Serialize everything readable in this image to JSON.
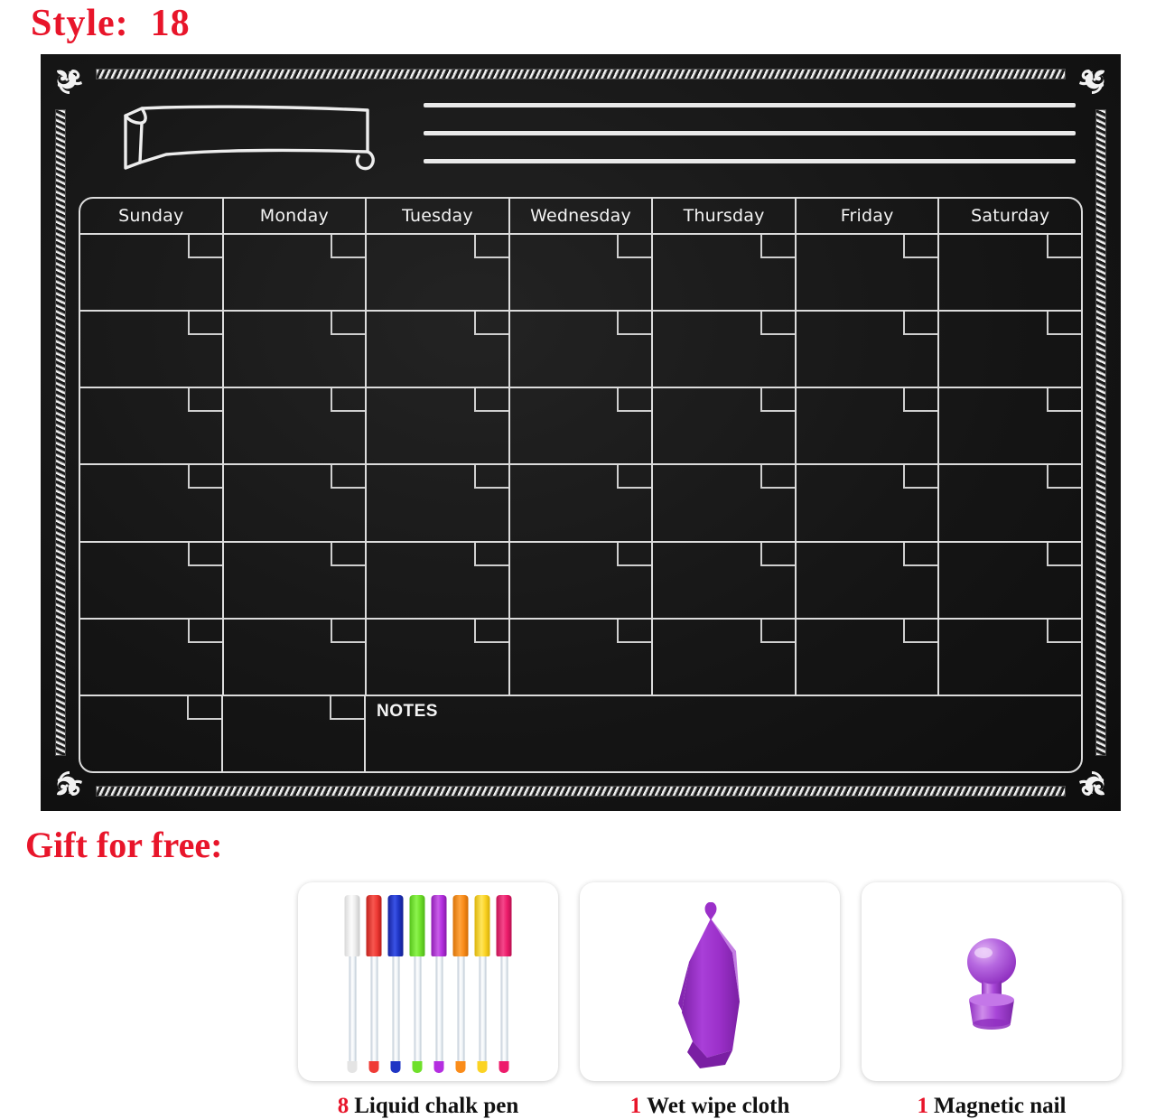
{
  "style": {
    "label": "Style:",
    "value": "18"
  },
  "board": {
    "background_color": "#161616",
    "chalk_color": "#e9e9e9",
    "ribbon_name": "month-title-ribbon",
    "date_lines_count": 3,
    "calendar": {
      "day_headers": [
        "Sunday",
        "Monday",
        "Tuesday",
        "Wednesday",
        "Thursday",
        "Friday",
        "Saturday"
      ],
      "week_rows": 6,
      "notes_row": {
        "day_cells": 2,
        "notes_label": "NOTES"
      }
    },
    "ornaments": [
      "corner-flourish-top-left",
      "corner-flourish-top-right",
      "corner-flourish-bottom-left",
      "corner-flourish-bottom-right"
    ]
  },
  "gift": {
    "heading": "Gift for free:",
    "accent_color": "#e8152a",
    "items": [
      {
        "name": "liquid-chalk-pens",
        "qty": "8",
        "caption": "Liquid chalk pen",
        "icon": "marker-pens-icon",
        "pen_colors": [
          "#f1f1f1",
          "#ef3b36",
          "#1f35c4",
          "#6fe02a",
          "#b42ee0",
          "#fa8c1a",
          "#fbd324",
          "#ed1c6b"
        ]
      },
      {
        "name": "wet-wipe-cloth",
        "qty": "1",
        "caption": "Wet wipe cloth",
        "icon": "hanging-towel-icon",
        "color": "#9b30c9"
      },
      {
        "name": "magnetic-nail",
        "qty": "1",
        "caption": "Magnetic nail",
        "icon": "magnetic-pushpin-icon",
        "color": "#a846d8"
      }
    ]
  }
}
